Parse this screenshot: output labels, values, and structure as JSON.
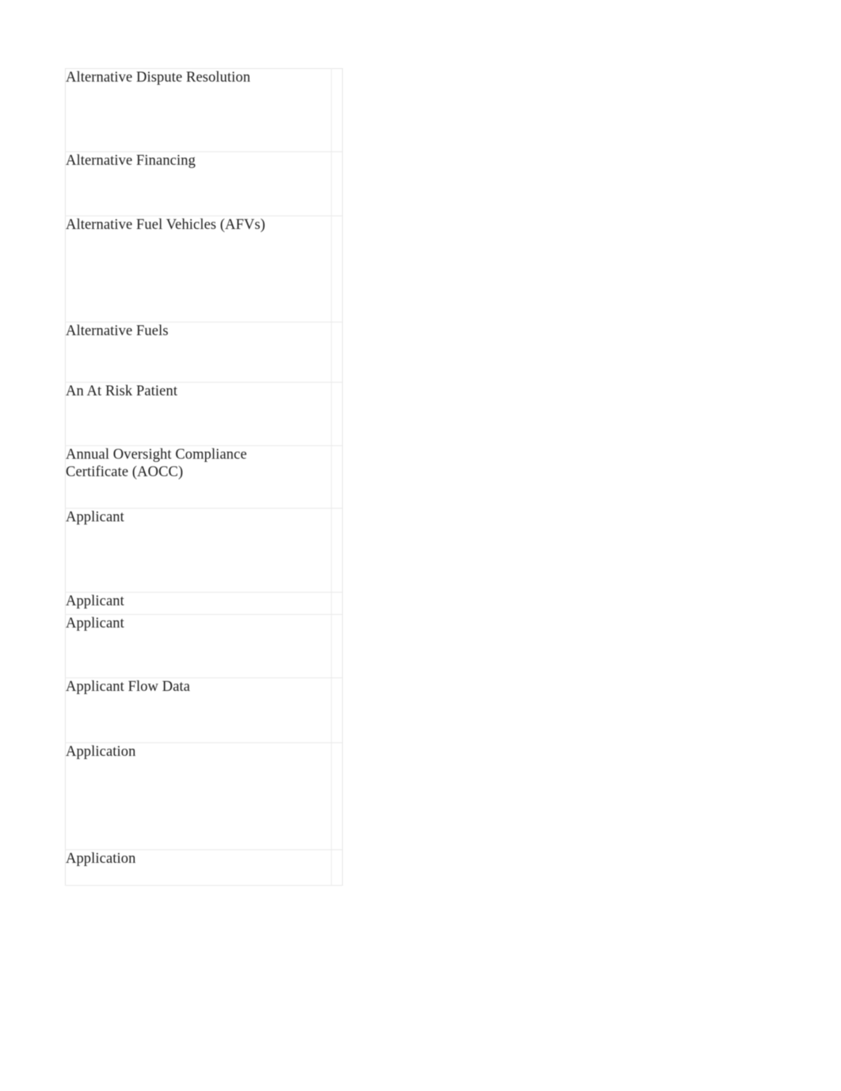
{
  "document": {
    "page_background": "#ffffff",
    "text_color": "#1b1b1b",
    "rule_color": "#e9e9e9",
    "type": "glossary-table"
  },
  "table": {
    "columns": [
      {
        "key": "term",
        "header": ""
      },
      {
        "key": "definition",
        "header": ""
      }
    ],
    "rows": [
      {
        "term": "Alternative Dispute Resolution",
        "definition": ""
      },
      {
        "term": "Alternative Financing",
        "definition": ""
      },
      {
        "term": "Alternative Fuel Vehicles (AFVs)",
        "definition": ""
      },
      {
        "term": "Alternative Fuels",
        "definition": ""
      },
      {
        "term": "An At Risk Patient",
        "definition": ""
      },
      {
        "term": "Annual Oversight Compliance\nCertificate (AOCC)",
        "definition": ""
      },
      {
        "term": "Applicant",
        "definition": ""
      },
      {
        "term": "Applicant",
        "definition": ""
      },
      {
        "term": "Applicant",
        "definition": ""
      },
      {
        "term": "Applicant Flow Data",
        "definition": ""
      },
      {
        "term": "Application",
        "definition": ""
      },
      {
        "term": "Application",
        "definition": ""
      }
    ]
  }
}
